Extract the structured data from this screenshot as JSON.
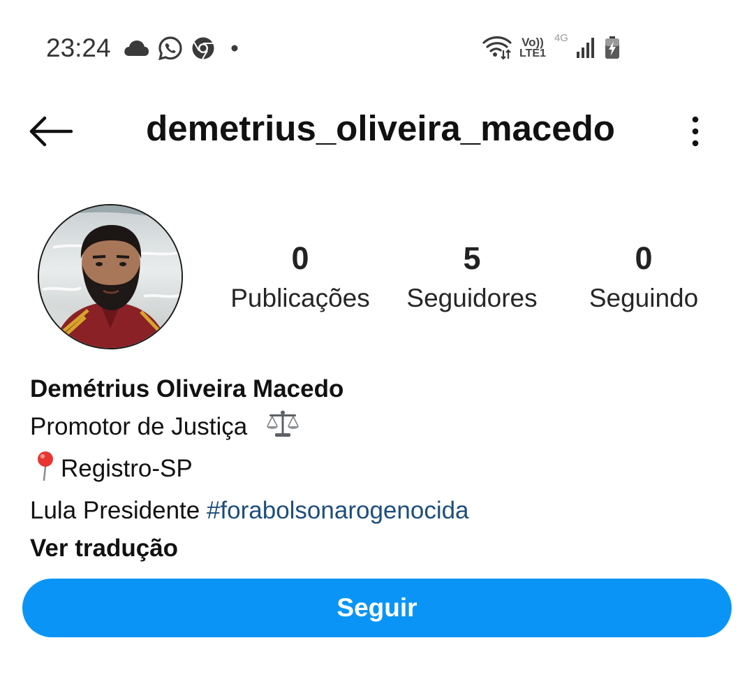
{
  "status_bar": {
    "time": "23:24",
    "left_icons": [
      "cloud-icon",
      "whatsapp-icon",
      "chrome-icon",
      "notification-dot-icon"
    ],
    "right_icons": [
      "wifi-icon",
      "volte-icon",
      "signal-icon",
      "battery-charging-icon"
    ],
    "volte_top": "Vo))",
    "volte_bottom": "LTE1",
    "network_type": "4G"
  },
  "header": {
    "username": "demetrius_oliveira_macedo",
    "back_icon": "arrow-left-icon",
    "more_icon": "more-vertical-icon"
  },
  "profile": {
    "avatar": "profile-photo",
    "stats": [
      {
        "number": "0",
        "label": "Publicações"
      },
      {
        "number": "5",
        "label": "Seguidores"
      },
      {
        "number": "0",
        "label": "Seguindo"
      }
    ]
  },
  "bio": {
    "name": "Demétrius Oliveira Macedo",
    "occupation": "Promotor de Justiça",
    "occupation_icon": "scales-icon",
    "location": "Registro-SP",
    "location_icon": "pin-icon",
    "politics_text": "Lula Presidente ",
    "hashtag": "#forabolsonarogenocida",
    "translate_link": "Ver tradução"
  },
  "actions": {
    "follow_label": "Seguir"
  },
  "colors": {
    "follow_button": "#0a95f6",
    "hashtag": "#1d4e7c",
    "text": "#111111"
  }
}
